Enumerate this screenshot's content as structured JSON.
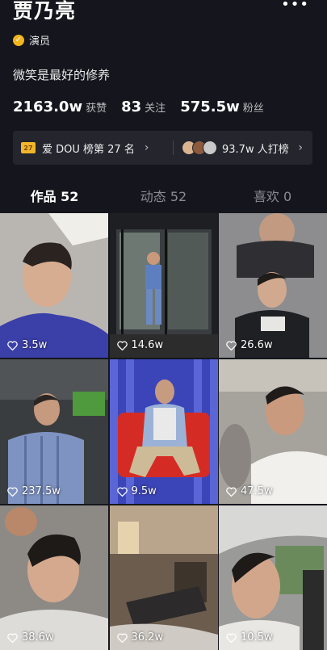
{
  "profile": {
    "name": "贾乃亮",
    "verified_label": "演员",
    "bio": "微笑是最好的修养",
    "more_icon": "more-dots-icon"
  },
  "stats": [
    {
      "value": "2163.0w",
      "label": "获赞"
    },
    {
      "value": "83",
      "label": "关注"
    },
    {
      "value": "575.5w",
      "label": "粉丝"
    }
  ],
  "banner": {
    "rank_icon_text": "27",
    "rank_text": "爱 DOU 榜第 27 名",
    "fans_text": "93.7w 人打榜"
  },
  "tabs": [
    {
      "label": "作品 52"
    },
    {
      "label": "动态 52"
    },
    {
      "label": "喜欢 0"
    }
  ],
  "videos": [
    {
      "likes": "3.5w"
    },
    {
      "likes": "14.6w"
    },
    {
      "likes": "26.6w"
    },
    {
      "likes": "237.5w"
    },
    {
      "likes": "9.5w"
    },
    {
      "likes": "47.5w"
    },
    {
      "likes": "38.6w"
    },
    {
      "likes": "36.2w"
    },
    {
      "likes": "10.5w"
    }
  ],
  "colors": {
    "background": "#15161d",
    "highlight": "#e5262b",
    "badge": "#f2b51c"
  }
}
